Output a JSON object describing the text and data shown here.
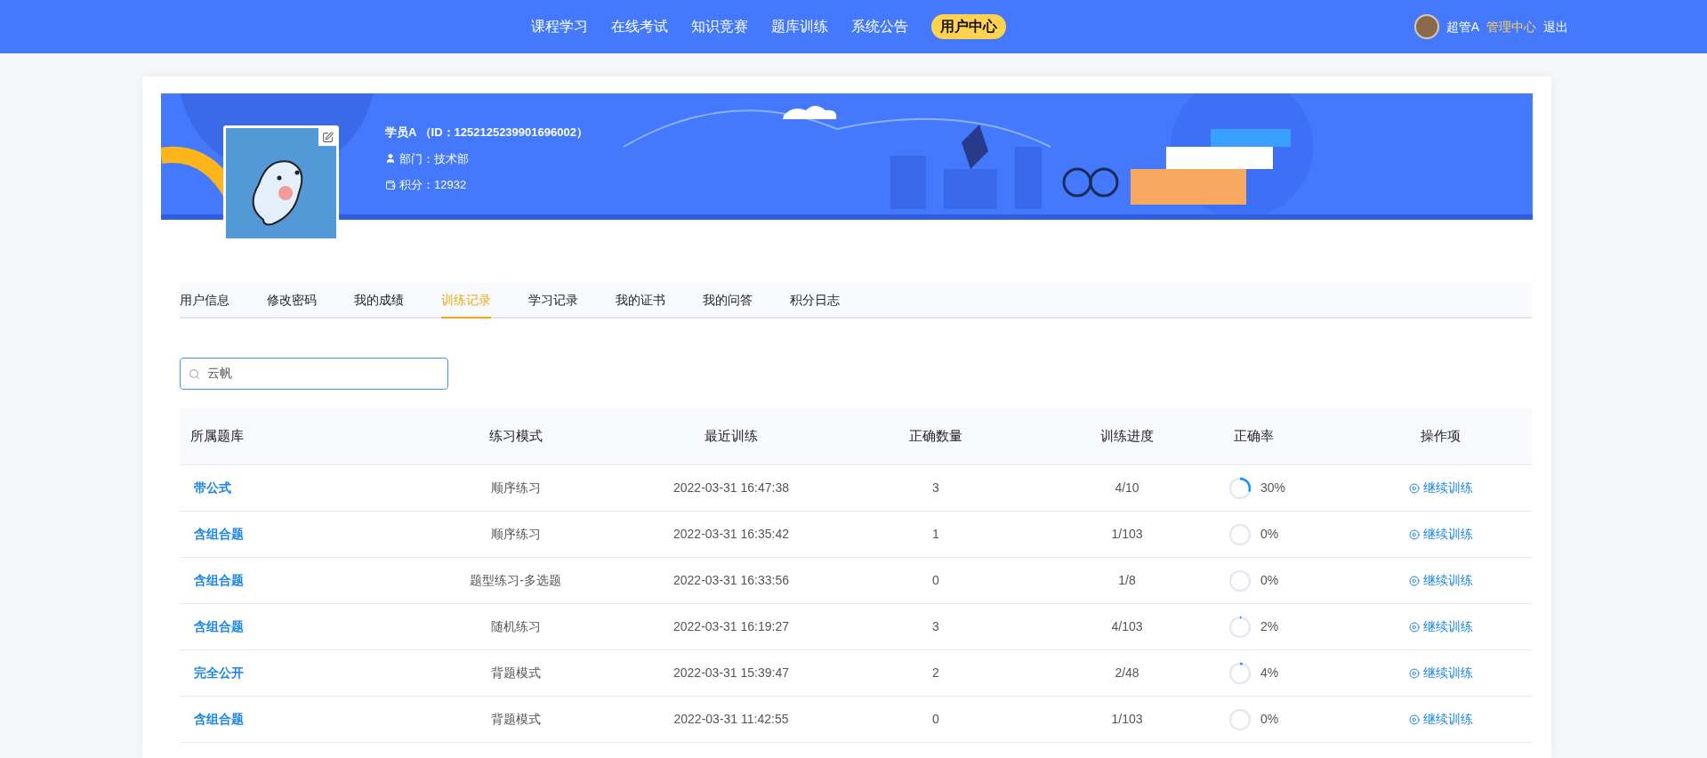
{
  "nav": {
    "items": [
      {
        "label": "课程学习",
        "selected": false
      },
      {
        "label": "在线考试",
        "selected": false
      },
      {
        "label": "知识竞赛",
        "selected": false
      },
      {
        "label": "题库训练",
        "selected": false
      },
      {
        "label": "系统公告",
        "selected": false
      },
      {
        "label": "用户中心",
        "selected": true
      }
    ],
    "user": "超管A",
    "admin": "管理中心",
    "logout": "退出"
  },
  "profile": {
    "name": "学员A （ID：1252125239901696002）",
    "department": "部门：技术部",
    "points": "积分：12932"
  },
  "tabs": [
    {
      "label": "用户信息",
      "selected": false
    },
    {
      "label": "修改密码",
      "selected": false
    },
    {
      "label": "我的成绩",
      "selected": false
    },
    {
      "label": "训练记录",
      "selected": true
    },
    {
      "label": "学习记录",
      "selected": false
    },
    {
      "label": "我的证书",
      "selected": false
    },
    {
      "label": "我的问答",
      "selected": false
    },
    {
      "label": "积分日志",
      "selected": false
    }
  ],
  "search": {
    "value": "云帆"
  },
  "table": {
    "columns": [
      "所属题库",
      "练习模式",
      "最近训练",
      "正确数量",
      "训练进度",
      "正确率",
      "操作项"
    ],
    "rows": [
      {
        "bank": "带公式",
        "mode": "顺序练习",
        "time": "2022-03-31 16:47:38",
        "correct": "3",
        "progress": "4/10",
        "level": 0.3,
        "rate": "30%",
        "action": "继续训练"
      },
      {
        "bank": "含组合题",
        "mode": "顺序练习",
        "time": "2022-03-31 16:35:42",
        "correct": "1",
        "progress": "1/103",
        "level": 0,
        "rate": "0%",
        "action": "继续训练"
      },
      {
        "bank": "含组合题",
        "mode": "题型练习-多选题",
        "time": "2022-03-31 16:33:56",
        "correct": "0",
        "progress": "1/8",
        "level": 0,
        "rate": "0%",
        "action": "继续训练"
      },
      {
        "bank": "含组合题",
        "mode": "随机练习",
        "time": "2022-03-31 16:19:27",
        "correct": "3",
        "progress": "4/103",
        "level": 0.02,
        "rate": "2%",
        "action": "继续训练"
      },
      {
        "bank": "完全公开",
        "mode": "背题模式",
        "time": "2022-03-31 15:39:47",
        "correct": "2",
        "progress": "2/48",
        "level": 0.04,
        "rate": "4%",
        "action": "继续训练"
      },
      {
        "bank": "含组合题",
        "mode": "背题模式",
        "time": "2022-03-31 11:42:55",
        "correct": "0",
        "progress": "1/103",
        "level": 0,
        "rate": "0%",
        "action": "继续训练"
      }
    ]
  }
}
